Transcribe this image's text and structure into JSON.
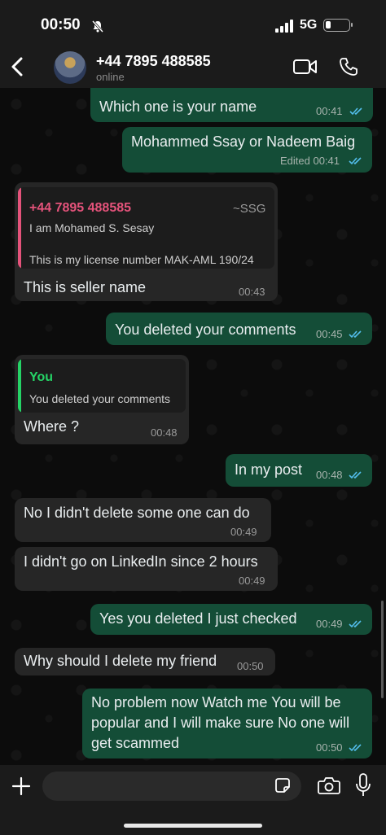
{
  "status_bar": {
    "time": "00:50",
    "network": "5G"
  },
  "header": {
    "contact_name": "+44 7895 488585",
    "status": "online"
  },
  "messages": [
    {
      "text": "Which one is your name",
      "time": "00:41"
    },
    {
      "text": "Mohammed Ssay or Nadeem Baig",
      "time": "Edited 00:41"
    },
    {
      "quote_name": "+44 7895 488585",
      "quote_tag": "~SSG",
      "quote_line1": "I am Mohamed S. Sesay",
      "quote_line2": "This is my license number MAK-AML 190/24",
      "text": "This is seller name",
      "time": "00:43"
    },
    {
      "text": "You deleted your comments",
      "time": "00:45"
    },
    {
      "quote_name": "You",
      "quote_line1": "You deleted your comments",
      "text": "Where ?",
      "time": "00:48"
    },
    {
      "text": "In my post",
      "time": "00:48"
    },
    {
      "text": "No I didn't delete some one can do",
      "time": "00:49"
    },
    {
      "text": "I didn't go on LinkedIn since 2 hours",
      "time": "00:49"
    },
    {
      "text": "Yes you deleted I just checked",
      "time": "00:49"
    },
    {
      "text": "Why should I delete my friend",
      "time": "00:50"
    },
    {
      "line1": "No problem now Watch me You will be",
      "line2": "popular and I will make sure No one will",
      "line3": "get scammed",
      "time": "00:50"
    }
  ],
  "colors": {
    "outgoing": "#144d37",
    "incoming": "#262626",
    "read_ticks": "#53bdeb",
    "quote_pink": "#e5537b",
    "quote_green": "#25d366"
  },
  "icons": [
    "chevron-left-icon",
    "video-call-icon",
    "phone-icon",
    "plus-icon",
    "sticker-icon",
    "camera-icon",
    "mic-icon",
    "bell-slash-icon",
    "double-check-icon"
  ]
}
